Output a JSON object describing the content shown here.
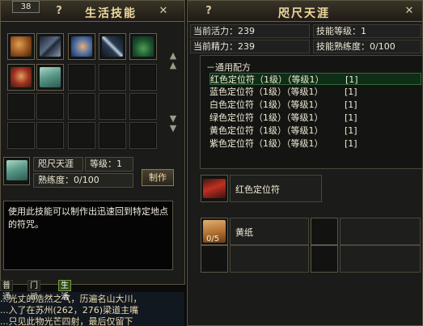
{
  "left_panel": {
    "title": "生活技能",
    "level_badge": "38",
    "help_label": "?",
    "close_label": "✕",
    "arrow_up": "▲",
    "arrow_down": "▼",
    "grid_icons": [
      "scroll-quill-icon",
      "crossed-swords-icon",
      "hand-casting-icon",
      "blade-icon",
      "herb-icon",
      "warrior-portrait-icon",
      "map-scroll-icon"
    ],
    "skill_name": "咫尺天涯",
    "level_text": "等级：1",
    "proficiency_text": "熟练度：0/100",
    "make_button": "制作",
    "description": "使用此技能可以制作出迅速回到特定地点的符咒。"
  },
  "chat": {
    "tabs": [
      "普通",
      "门派",
      "生活"
    ],
    "lines": [
      "...光丈的浩然之气，历遍名山大川，",
      "...入了在苏州(262，276)梁道主嘴",
      "...只见此物光芒四射，最后仅留下"
    ]
  },
  "right_panel": {
    "title": "咫尺天涯",
    "help_label": "?",
    "close_label": "✕",
    "vitality": "当前活力：239",
    "skill_level": "技能等级：1",
    "energy": "当前精力：239",
    "skill_proficiency": "技能熟练度：0/100",
    "recipe_header": "－通用配方",
    "recipes": [
      {
        "name": "红色定位符（1级）（等级1）",
        "count": "[1]"
      },
      {
        "name": "蓝色定位符（1级）（等级1）",
        "count": "[1]"
      },
      {
        "name": "白色定位符（1级）（等级1）",
        "count": "[1]"
      },
      {
        "name": "绿色定位符（1级）（等级1）",
        "count": "[1]"
      },
      {
        "name": "黄色定位符（1级）（等级1）",
        "count": "[1]"
      },
      {
        "name": "紫色定位符（1级）（等级1）",
        "count": "[1]"
      }
    ],
    "output_item": "红色定位符",
    "material_item": "黄纸",
    "material_count": "0/5"
  },
  "colors": {
    "gold_title": "#f0d9a0",
    "selected_row": "#0f2e16",
    "chat_highlight": "#7ad04a"
  }
}
